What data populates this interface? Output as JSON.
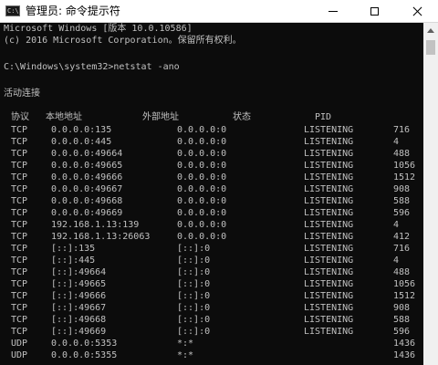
{
  "window": {
    "title": "管理员: 命令提示符",
    "icon_text": "C:\\"
  },
  "console": {
    "banner": [
      "Microsoft Windows [版本 10.0.10586]",
      "(c) 2016 Microsoft Corporation。保留所有权利。"
    ],
    "prompt": "C:\\Windows\\system32>netstat -ano",
    "section_title": "活动连接",
    "headers": [
      "协议",
      "本地地址",
      "外部地址",
      "状态",
      "PID"
    ],
    "rows": [
      [
        "TCP",
        "0.0.0.0:135",
        "0.0.0.0:0",
        "LISTENING",
        "716"
      ],
      [
        "TCP",
        "0.0.0.0:445",
        "0.0.0.0:0",
        "LISTENING",
        "4"
      ],
      [
        "TCP",
        "0.0.0.0:49664",
        "0.0.0.0:0",
        "LISTENING",
        "488"
      ],
      [
        "TCP",
        "0.0.0.0:49665",
        "0.0.0.0:0",
        "LISTENING",
        "1056"
      ],
      [
        "TCP",
        "0.0.0.0:49666",
        "0.0.0.0:0",
        "LISTENING",
        "1512"
      ],
      [
        "TCP",
        "0.0.0.0:49667",
        "0.0.0.0:0",
        "LISTENING",
        "908"
      ],
      [
        "TCP",
        "0.0.0.0:49668",
        "0.0.0.0:0",
        "LISTENING",
        "588"
      ],
      [
        "TCP",
        "0.0.0.0:49669",
        "0.0.0.0:0",
        "LISTENING",
        "596"
      ],
      [
        "TCP",
        "192.168.1.13:139",
        "0.0.0.0:0",
        "LISTENING",
        "4"
      ],
      [
        "TCP",
        "192.168.1.13:26063",
        "0.0.0.0:0",
        "LISTENING",
        "412"
      ],
      [
        "TCP",
        "[::]:135",
        "[::]:0",
        "LISTENING",
        "716"
      ],
      [
        "TCP",
        "[::]:445",
        "[::]:0",
        "LISTENING",
        "4"
      ],
      [
        "TCP",
        "[::]:49664",
        "[::]:0",
        "LISTENING",
        "488"
      ],
      [
        "TCP",
        "[::]:49665",
        "[::]:0",
        "LISTENING",
        "1056"
      ],
      [
        "TCP",
        "[::]:49666",
        "[::]:0",
        "LISTENING",
        "1512"
      ],
      [
        "TCP",
        "[::]:49667",
        "[::]:0",
        "LISTENING",
        "908"
      ],
      [
        "TCP",
        "[::]:49668",
        "[::]:0",
        "LISTENING",
        "588"
      ],
      [
        "TCP",
        "[::]:49669",
        "[::]:0",
        "LISTENING",
        "596"
      ],
      [
        "UDP",
        "0.0.0.0:5353",
        "*:*",
        "",
        "1436"
      ],
      [
        "UDP",
        "0.0.0.0:5355",
        "*:*",
        "",
        "1436"
      ]
    ]
  },
  "colors": {
    "console_bg": "#0c0c0c",
    "console_text": "#c0c0c0",
    "titlebar_bg": "#ffffff"
  }
}
